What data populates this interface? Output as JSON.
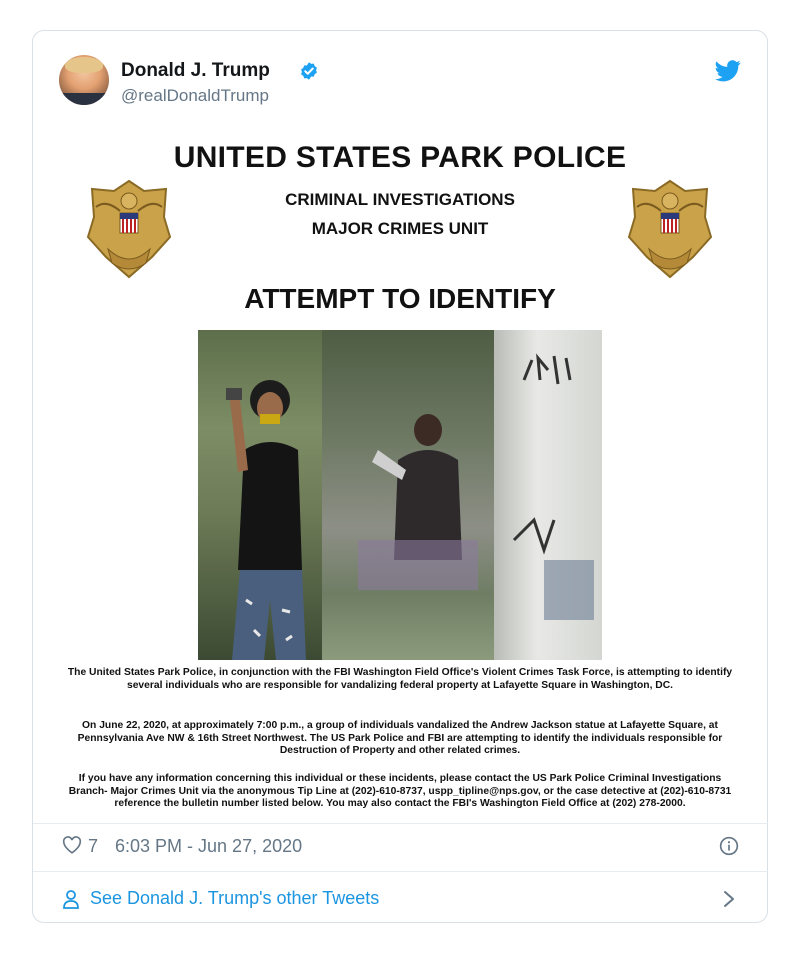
{
  "tweet": {
    "display_name": "Donald J. Trump",
    "handle": "@realDonaldTrump",
    "likes": "7",
    "timestamp": "6:03 PM - Jun 27, 2020",
    "more_tweets_link": "See Donald J. Trump's other Tweets"
  },
  "poster": {
    "title": "UNITED STATES PARK POLICE",
    "subtitle1": "CRIMINAL INVESTIGATIONS",
    "subtitle2": "MAJOR CRIMES UNIT",
    "heading": "ATTEMPT TO IDENTIFY",
    "paragraph1": "The United States Park Police, in conjunction with the FBI Washington Field Office's Violent Crimes Task Force, is attempting to identify several individuals who are responsible for vandalizing federal property at Lafayette Square in Washington, DC.",
    "paragraph2": "On June 22, 2020, at approximately 7:00 p.m., a group of individuals vandalized the Andrew Jackson statue at Lafayette Square, at Pennsylvania Ave NW & 16th Street Northwest.  The US Park Police and FBI are attempting to identify the individuals responsible for Destruction of Property and other related crimes.",
    "paragraph3": "If you have any information concerning this individual or these incidents, please contact the US Park Police Criminal Investigations Branch- Major Crimes Unit via the anonymous Tip Line at (202)-610-8737, uspp_tipline@nps.gov, or the case detective at (202)-610-8731 reference the bulletin number listed below. You may also contact the FBI's Washington Field Office at (202) 278-2000."
  },
  "colors": {
    "accent": "#1da1f2",
    "link": "#1b95e0",
    "muted": "#657786",
    "badge_gold": "#c9a24a"
  },
  "icons": [
    "verified-badge-icon",
    "twitter-bird-icon",
    "heart-icon",
    "info-icon",
    "person-icon",
    "chevron-right-icon"
  ]
}
